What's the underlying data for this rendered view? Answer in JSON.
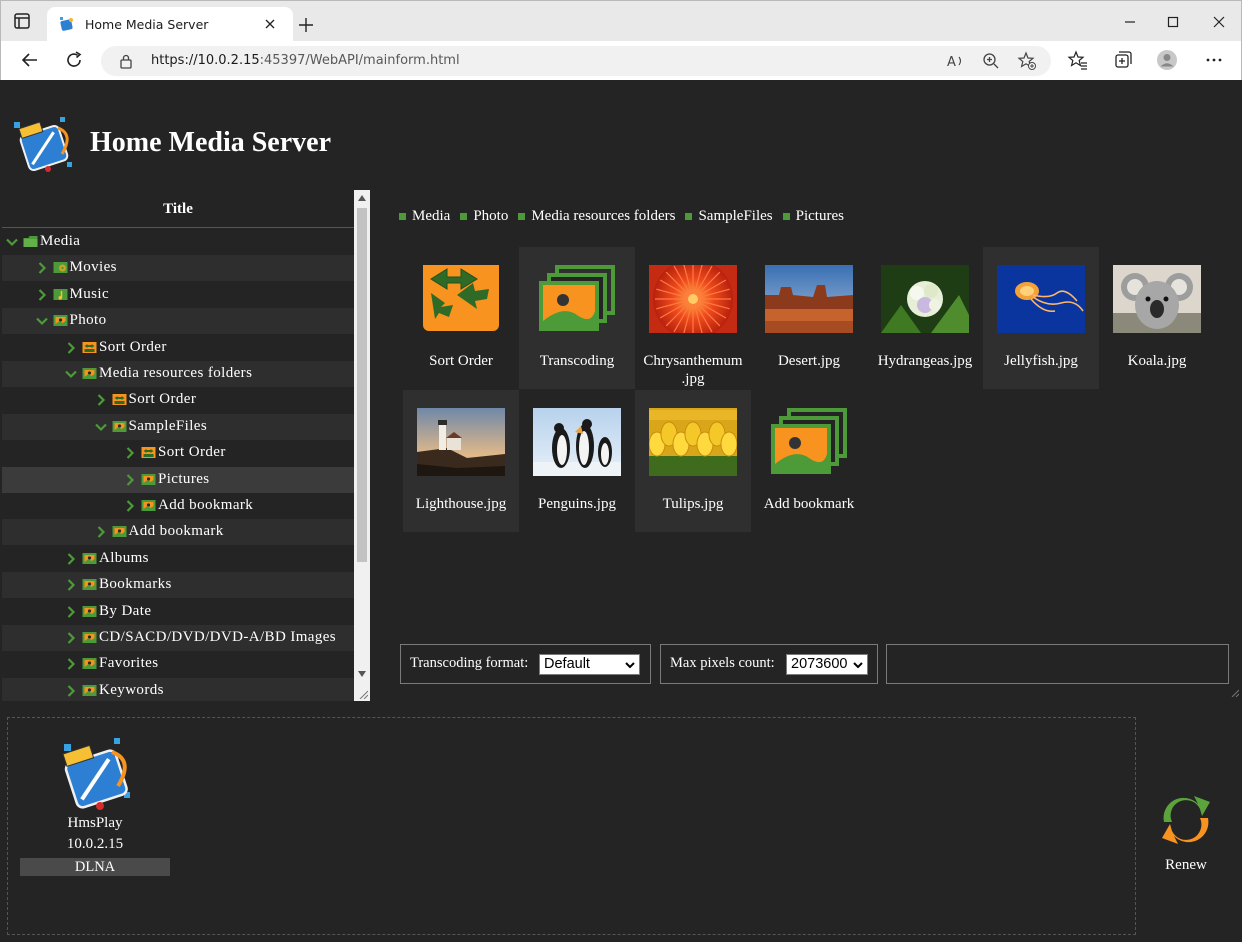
{
  "browser": {
    "tab_title": "Home Media Server",
    "url_host": "https://10.0.2.15",
    "url_rest": ":45397/WebAPI/mainform.html"
  },
  "header": {
    "title": "Home Media Server"
  },
  "tree": {
    "title": "Title",
    "items": [
      {
        "label": "Media",
        "level": 0,
        "expanded": true,
        "icon": "folder-icon"
      },
      {
        "label": "Movies",
        "level": 1,
        "expanded": false,
        "icon": "movies-icon"
      },
      {
        "label": "Music",
        "level": 1,
        "expanded": false,
        "icon": "music-icon"
      },
      {
        "label": "Photo",
        "level": 1,
        "expanded": true,
        "icon": "photo-icon"
      },
      {
        "label": "Sort Order",
        "level": 2,
        "expanded": false,
        "icon": "sort-icon"
      },
      {
        "label": "Media resources folders",
        "level": 2,
        "expanded": true,
        "icon": "photo-icon"
      },
      {
        "label": "Sort Order",
        "level": 3,
        "expanded": false,
        "icon": "sort-icon"
      },
      {
        "label": "SampleFiles",
        "level": 3,
        "expanded": true,
        "icon": "photo-icon"
      },
      {
        "label": "Sort Order",
        "level": 4,
        "expanded": false,
        "icon": "sort-icon"
      },
      {
        "label": "Pictures",
        "level": 4,
        "expanded": false,
        "icon": "photo-icon",
        "selected": true
      },
      {
        "label": "Add bookmark",
        "level": 4,
        "expanded": false,
        "icon": "photo-icon"
      },
      {
        "label": "Add bookmark",
        "level": 3,
        "expanded": false,
        "icon": "photo-icon"
      },
      {
        "label": "Albums",
        "level": 2,
        "expanded": false,
        "icon": "photo-icon"
      },
      {
        "label": "Bookmarks",
        "level": 2,
        "expanded": false,
        "icon": "photo-icon"
      },
      {
        "label": "By Date",
        "level": 2,
        "expanded": false,
        "icon": "photo-icon"
      },
      {
        "label": "CD/SACD/DVD/DVD-A/BD Images",
        "level": 2,
        "expanded": false,
        "icon": "photo-icon"
      },
      {
        "label": "Favorites",
        "level": 2,
        "expanded": false,
        "icon": "photo-icon"
      },
      {
        "label": "Keywords",
        "level": 2,
        "expanded": false,
        "icon": "photo-icon"
      }
    ]
  },
  "breadcrumb": [
    "Media",
    "Photo",
    "Media resources folders",
    "SampleFiles",
    "Pictures"
  ],
  "grid": [
    {
      "label": "Sort Order",
      "thumb": "sort-order-icon"
    },
    {
      "label": "Transcoding",
      "thumb": "transcoding-icon"
    },
    {
      "label": "Chrysanthemum .jpg",
      "thumb": "chrysanthemum"
    },
    {
      "label": "Desert.jpg",
      "thumb": "desert"
    },
    {
      "label": "Hydrangeas.jpg",
      "thumb": "hydrangeas"
    },
    {
      "label": "Jellyfish.jpg",
      "thumb": "jellyfish"
    },
    {
      "label": "Koala.jpg",
      "thumb": "koala"
    },
    {
      "label": "Lighthouse.jpg",
      "thumb": "lighthouse"
    },
    {
      "label": "Penguins.jpg",
      "thumb": "penguins"
    },
    {
      "label": "Tulips.jpg",
      "thumb": "tulips"
    },
    {
      "label": "Add bookmark",
      "thumb": "bookmark-icon"
    }
  ],
  "controls": {
    "transcoding_label": "Transcoding format:",
    "transcoding_value": "Default",
    "pixels_label": "Max pixels count:",
    "pixels_value": "2073600"
  },
  "device": {
    "name": "HmsPlay",
    "ip": "10.0.2.15",
    "type": "DLNA"
  },
  "renew": {
    "label": "Renew"
  },
  "colors": {
    "accent_green": "#4c9a38",
    "accent_orange": "#f7931e",
    "background": "#242424"
  }
}
